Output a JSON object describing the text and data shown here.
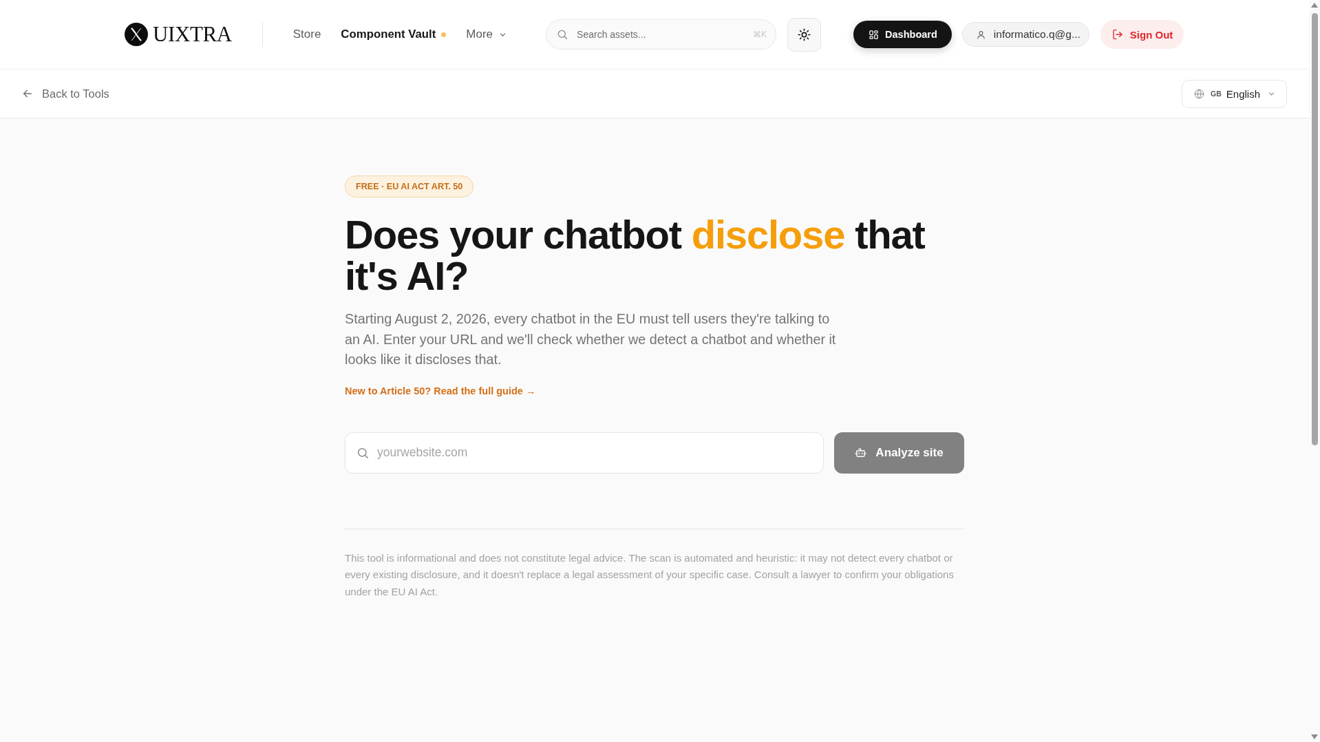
{
  "header": {
    "logo": {
      "text": "UIXTRA"
    },
    "nav": [
      {
        "label": "Store",
        "kind": "link",
        "selected": false,
        "dot": false
      },
      {
        "label": "Component Vault",
        "kind": "link",
        "selected": true,
        "dot": true
      },
      {
        "label": "More",
        "kind": "dropdown",
        "selected": false,
        "dot": false
      }
    ],
    "search": {
      "placeholder": "Search assets...",
      "shortcut": "⌘K"
    },
    "dashboard_button": {
      "label": "Dashboard"
    },
    "user_menu": {
      "label": "informatico.q@g..."
    },
    "sign_out_button": {
      "label": "Sign Out"
    }
  },
  "subheader": {
    "back_link": "Back to Tools",
    "language": {
      "flag_code": "GB",
      "label": "English"
    }
  },
  "hero": {
    "badge": "FREE · EU AI ACT ART. 50",
    "heading": [
      {
        "text": "Does your chatbot",
        "highlight": false
      },
      {
        "text": "disclose",
        "highlight": true
      },
      {
        "text": "that it's AI?",
        "highlight": false
      }
    ],
    "description": "Starting August 2, 2026, every chatbot in the EU must tell users they're talking to an AI. Enter your URL and we'll check whether we detect a chatbot and whether it looks like it discloses that.",
    "guide_link": "New to Article 50? Read the full guide →"
  },
  "analyzer": {
    "placeholder": "yourwebsite.com",
    "button": {
      "label": "Analyze site",
      "disabled": true
    }
  },
  "disclaimer": "This tool is informational and does not constitute legal advice. The scan is automated and heuristic: it may not detect every chatbot or every existing disclosure, and it doesn't replace a legal assessment of your specific case. Consult a lawyer to confirm your obligations under the EU AI Act."
}
